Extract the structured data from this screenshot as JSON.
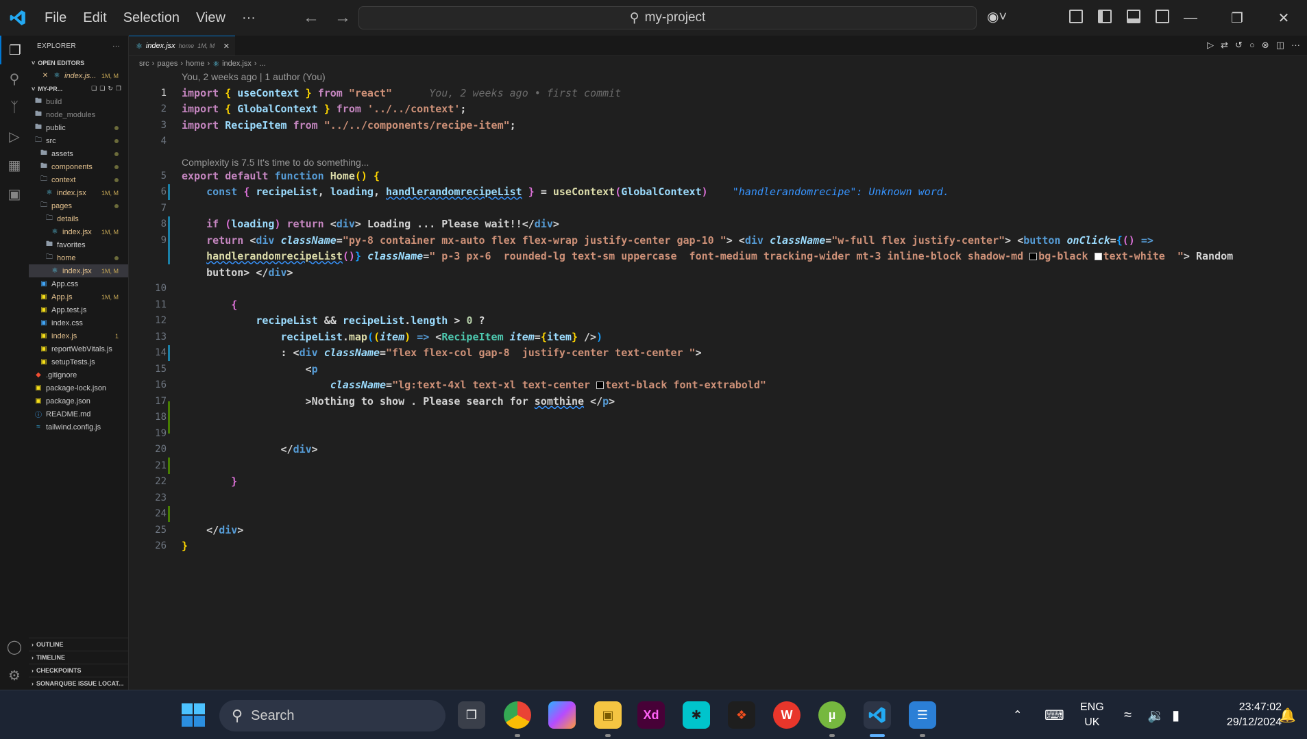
{
  "titlebar": {
    "menu": [
      "File",
      "Edit",
      "Selection",
      "View",
      "···"
    ],
    "search": "my-project"
  },
  "sidebar": {
    "header": "EXPLORER",
    "open_editors_label": "OPEN EDITORS",
    "open_editor_file": "index.js...",
    "open_editor_badge": "1M, M",
    "project_label": "MY-PR...",
    "tree": [
      {
        "name": "build",
        "indent": 0,
        "type": "folder",
        "style": "dim",
        "badge": ""
      },
      {
        "name": "node_modules",
        "indent": 0,
        "type": "folder",
        "style": "dim",
        "badge": ""
      },
      {
        "name": "public",
        "indent": 0,
        "type": "folder",
        "style": "normal",
        "badge": "dot"
      },
      {
        "name": "src",
        "indent": 0,
        "type": "folder-open",
        "style": "normal",
        "badge": "dot"
      },
      {
        "name": "assets",
        "indent": 1,
        "type": "folder",
        "style": "normal",
        "badge": "dot"
      },
      {
        "name": "components",
        "indent": 1,
        "type": "folder",
        "style": "mod",
        "badge": "dot"
      },
      {
        "name": "context",
        "indent": 1,
        "type": "folder-open",
        "style": "mod",
        "badge": "dot"
      },
      {
        "name": "index.jsx",
        "indent": 2,
        "type": "jsx",
        "style": "mod",
        "badge": "1M, M"
      },
      {
        "name": "pages",
        "indent": 1,
        "type": "folder-open",
        "style": "mod",
        "badge": "dot"
      },
      {
        "name": "details",
        "indent": 2,
        "type": "folder-open",
        "style": "mod",
        "badge": ""
      },
      {
        "name": "index.jsx",
        "indent": 3,
        "type": "jsx",
        "style": "mod",
        "badge": "1M, M"
      },
      {
        "name": "favorites",
        "indent": 2,
        "type": "folder",
        "style": "normal",
        "badge": ""
      },
      {
        "name": "home",
        "indent": 2,
        "type": "folder-open",
        "style": "mod",
        "badge": "dot"
      },
      {
        "name": "index.jsx",
        "indent": 3,
        "type": "jsx",
        "style": "mod",
        "badge": "1M, M",
        "selected": true
      },
      {
        "name": "App.css",
        "indent": 1,
        "type": "css",
        "style": "normal",
        "badge": ""
      },
      {
        "name": "App.js",
        "indent": 1,
        "type": "js",
        "style": "mod",
        "badge": "1M, M"
      },
      {
        "name": "App.test.js",
        "indent": 1,
        "type": "js",
        "style": "normal",
        "badge": ""
      },
      {
        "name": "index.css",
        "indent": 1,
        "type": "css",
        "style": "normal",
        "badge": ""
      },
      {
        "name": "index.js",
        "indent": 1,
        "type": "js",
        "style": "mod",
        "badge": "1"
      },
      {
        "name": "reportWebVitals.js",
        "indent": 1,
        "type": "js",
        "style": "normal",
        "badge": ""
      },
      {
        "name": "setupTests.js",
        "indent": 1,
        "type": "js",
        "style": "normal",
        "badge": ""
      },
      {
        "name": ".gitignore",
        "indent": 0,
        "type": "git",
        "style": "normal",
        "badge": ""
      },
      {
        "name": "package-lock.json",
        "indent": 0,
        "type": "json",
        "style": "normal",
        "badge": ""
      },
      {
        "name": "package.json",
        "indent": 0,
        "type": "json",
        "style": "normal",
        "badge": ""
      },
      {
        "name": "README.md",
        "indent": 0,
        "type": "info",
        "style": "normal",
        "badge": ""
      },
      {
        "name": "tailwind.config.js",
        "indent": 0,
        "type": "tw",
        "style": "normal",
        "badge": ""
      }
    ],
    "bottom_sections": [
      "OUTLINE",
      "TIMELINE",
      "CHECKPOINTS",
      "SONARQUBE ISSUE LOCAT..."
    ]
  },
  "editor": {
    "tab_name": "index.jsx",
    "tab_path": "home",
    "tab_badge": "1M, M",
    "breadcrumb": [
      "src",
      "pages",
      "home",
      "index.jsx",
      "..."
    ],
    "codelens_top": "You, 2 weeks ago | 1 author (You)",
    "codelens_complexity": "Complexity is 7.5 It's time to do something...",
    "blame_hint": "You, 2 weeks ago • first commit",
    "error_hint": "\"handlerandomrecipe\": Unknown word.",
    "line_numbers": [
      "1",
      "2",
      "3",
      "4",
      "5",
      "6",
      "7",
      "8",
      "9",
      "10",
      "11",
      "12",
      "13",
      "14",
      "15",
      "16",
      "17",
      "18",
      "19",
      "20",
      "21",
      "22",
      "23",
      "24",
      "25",
      "26"
    ]
  },
  "taskbar": {
    "search": "Search",
    "lang_1": "ENG",
    "lang_2": "UK",
    "time": "23:47:02",
    "date": "29/12/2024"
  },
  "colors": {
    "accent": "#0078d4",
    "editor_bg": "#1f1f1f",
    "taskbar_bg": "#1c2433"
  }
}
